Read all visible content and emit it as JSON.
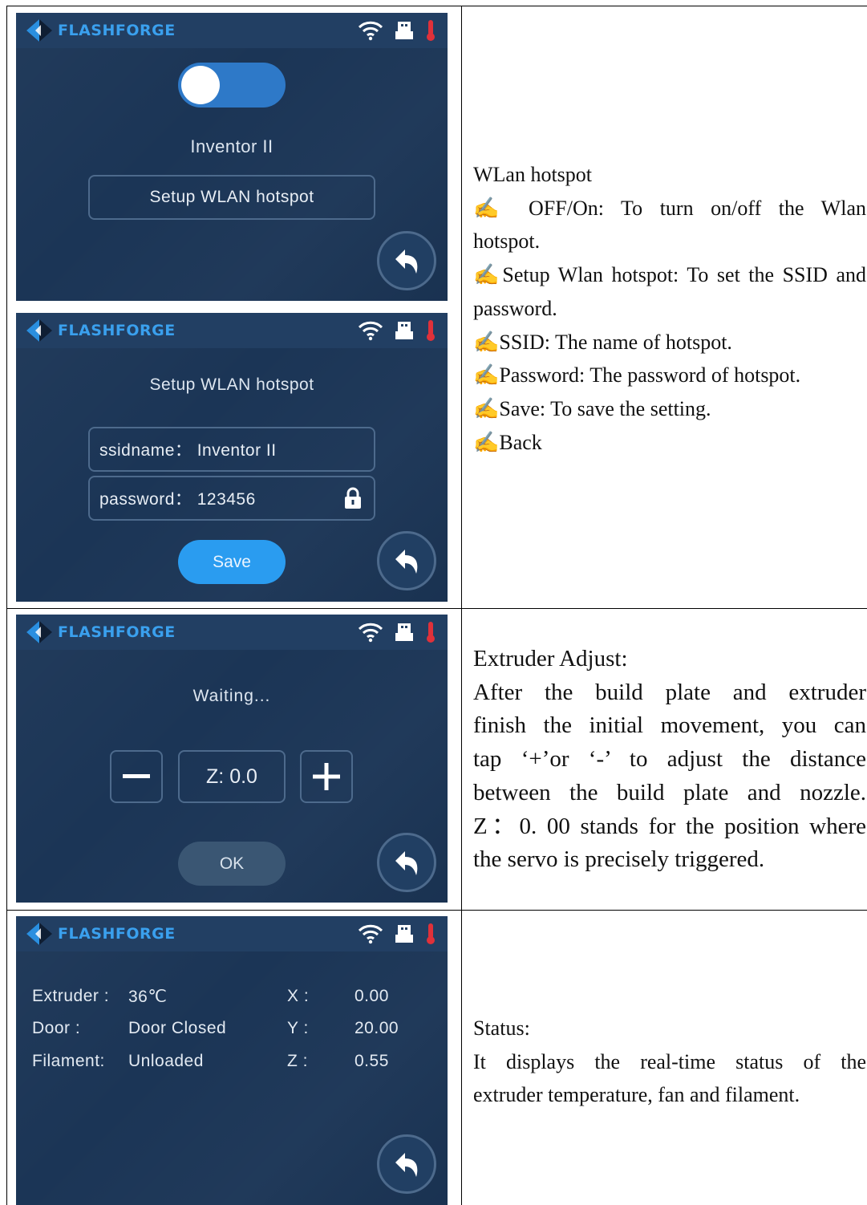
{
  "brand": "FLASHFORGE",
  "screen1": {
    "device_name": "Inventor II",
    "setup_button": "Setup WLAN hotspot"
  },
  "screen2": {
    "title": "Setup WLAN hotspot",
    "ssid_field": "ssidname：  Inventor II",
    "password_field": "password：  123456",
    "save_button": "Save"
  },
  "screen3": {
    "status": "Waiting...",
    "z_value": "Z: 0.0",
    "ok_button": "OK"
  },
  "screen4": {
    "rows": [
      {
        "label": "Extruder :",
        "value": "36℃",
        "axis": "X :",
        "axis_value": "0.00"
      },
      {
        "label": "Door :",
        "value": "Door Closed",
        "axis": "Y :",
        "axis_value": "20.00"
      },
      {
        "label": "Filament:",
        "value": "Unloaded",
        "axis": "Z :",
        "axis_value": "0.55"
      }
    ]
  },
  "desc1": {
    "title": "WLan hotspot",
    "line1a": "✍ OFF/On:  To  turn  on/off  the  Wlan",
    "line1b": "hotspot.",
    "line2a": "✍Setup Wlan hotspot: To set the SSID and",
    "line2b": "password.",
    "line3": "✍SSID: The name of hotspot.",
    "line4": "✍Password: The password of hotspot.",
    "line5": "✍Save: To save the setting.",
    "line6": "✍Back"
  },
  "desc2": {
    "title": "Extruder Adjust:",
    "l1": "After  the  build  plate  and  extruder",
    "l2": "finish  the  initial  movement,  you  can",
    "l3": "tap  ‘+’or  ‘-’  to  adjust  the  distance",
    "l4": "between  the  build  plate  and  nozzle.",
    "l5": "Z：0. 00 stands for the position where",
    "l6": "the servo is precisely triggered."
  },
  "desc3": {
    "title": "Status:",
    "l1": "It  displays  the  real-time  status  of  the",
    "l2": "extruder temperature, fan and filament."
  },
  "colors": {
    "screen_bg": "#1b3556",
    "header_bg": "#223f63",
    "brand_blue": "#3aa0ee",
    "save_blue": "#2a9cf0",
    "thermo_red": "#e0313a"
  },
  "icons": [
    "logo-icon",
    "wifi-icon",
    "usb-icon",
    "thermometer-icon",
    "back-icon",
    "lock-icon",
    "minus-icon",
    "plus-icon"
  ]
}
